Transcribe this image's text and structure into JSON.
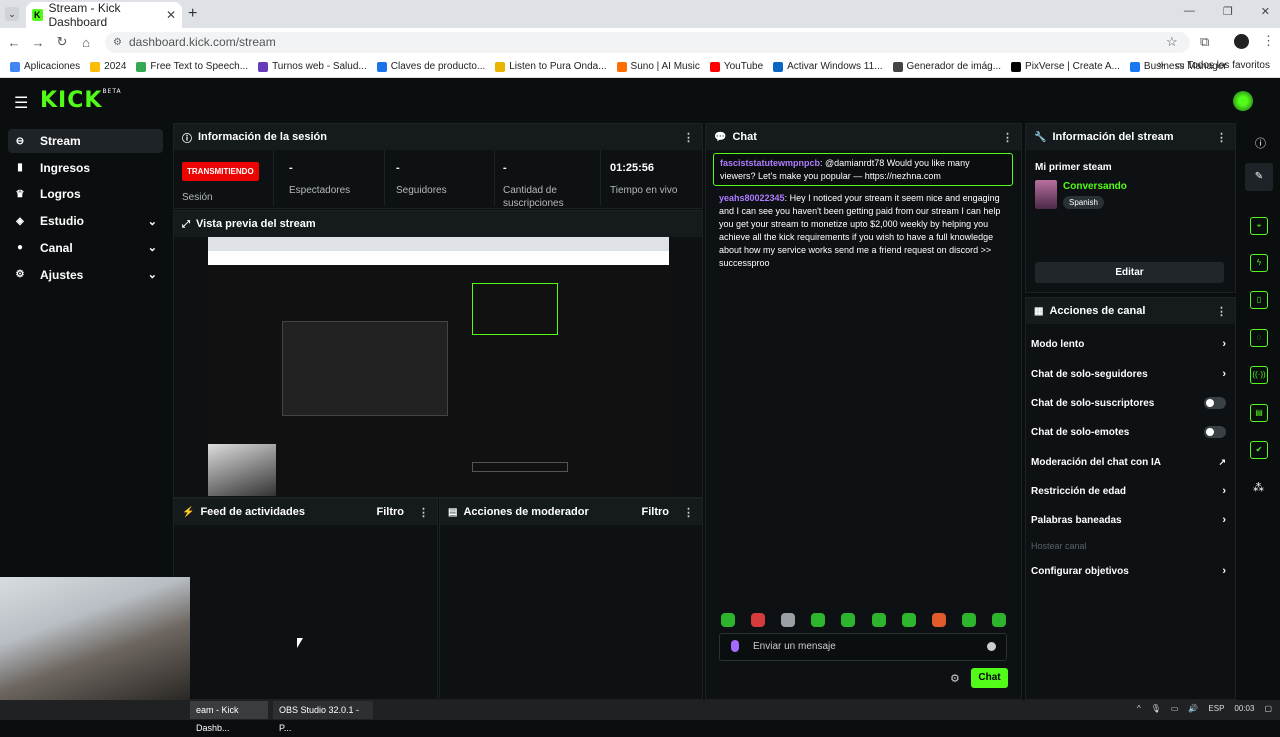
{
  "browser": {
    "tab_title": "Stream - Kick Dashboard",
    "url": "dashboard.kick.com/stream",
    "bookmarks": [
      "Aplicaciones",
      "2024",
      "Free Text to Speech...",
      "Turnos web - Salud...",
      "Claves de producto...",
      "Listen to Pura Onda...",
      "Suno | AI Music",
      "YouTube",
      "Activar Windows 11...",
      "Generador de imág...",
      "PixVerse | Create A...",
      "Business Manager"
    ],
    "bookmarks_folder": "Todos los favoritos"
  },
  "app": {
    "logo": "KICK",
    "logo_badge": "BETA",
    "brand_color": "#53fc18",
    "sidebar": [
      {
        "label": "Stream",
        "icon": "link-icon",
        "active": true
      },
      {
        "label": "Ingresos",
        "icon": "bars-icon"
      },
      {
        "label": "Logros",
        "icon": "trophy-icon"
      },
      {
        "label": "Estudio",
        "icon": "layers-icon",
        "expandable": true
      },
      {
        "label": "Canal",
        "icon": "user-icon",
        "expandable": true
      },
      {
        "label": "Ajustes",
        "icon": "gear-icon",
        "expandable": true
      }
    ]
  },
  "session": {
    "title": "Información de la sesión",
    "status": "TRANSMITIENDO",
    "status_label": "Sesión",
    "viewers_value": "-",
    "viewers_label": "Espectadores",
    "followers_value": "-",
    "followers_label": "Seguidores",
    "subs_value": "-",
    "subs_label": "Cantidad de suscripciones",
    "live_time": "01:25:56",
    "live_time_label": "Tiempo en vivo"
  },
  "preview": {
    "title": "Vista previa del stream"
  },
  "activity": {
    "title": "Feed de actividades",
    "filter": "Filtro"
  },
  "modactions": {
    "title": "Acciones de moderador",
    "filter": "Filtro"
  },
  "chat": {
    "title": "Chat",
    "pinned": {
      "user": "fasciststatutewmpnpcb",
      "text": ": @damianrdt78 Would you like many viewers? Let's make you popular — https://nezhna.com"
    },
    "messages": [
      {
        "user": "yeahs80022345",
        "text": ": Hey I noticed your stream it seem nice and engaging and I can see you haven't been getting paid from our stream I can help you get your stream to monetize upto $2,000 weekly by helping you achieve all the kick requirements if you wish to have a full knowledge about how my service works send me a friend request on discord >> successproo"
      }
    ],
    "input_placeholder": "Enviar un mensaje",
    "send_label": "Chat"
  },
  "stream_info": {
    "title": "Información del stream",
    "stream_title": "Mi primer steam",
    "category": "Conversando",
    "language": "Spanish",
    "edit_label": "Editar"
  },
  "channel_actions": {
    "title": "Acciones de canal",
    "items": [
      {
        "label": "Modo lento",
        "control": "arrow"
      },
      {
        "label": "Chat de solo-seguidores",
        "control": "arrow"
      },
      {
        "label": "Chat de solo-suscriptores",
        "control": "toggle",
        "on": false
      },
      {
        "label": "Chat de solo-emotes",
        "control": "toggle",
        "on": false
      },
      {
        "label": "Moderación del chat con IA",
        "control": "external"
      },
      {
        "label": "Restricción de edad",
        "control": "arrow"
      },
      {
        "label": "Palabras baneadas",
        "control": "arrow"
      },
      {
        "label": "Hostear canal",
        "control": "none",
        "disabled": true
      },
      {
        "label": "Configurar objetivos",
        "control": "arrow"
      }
    ]
  },
  "taskbar": {
    "items": [
      "eam - Kick Dashb...",
      "OBS Studio 32.0.1 - P..."
    ],
    "lang": "ESP",
    "time": "00:03"
  }
}
